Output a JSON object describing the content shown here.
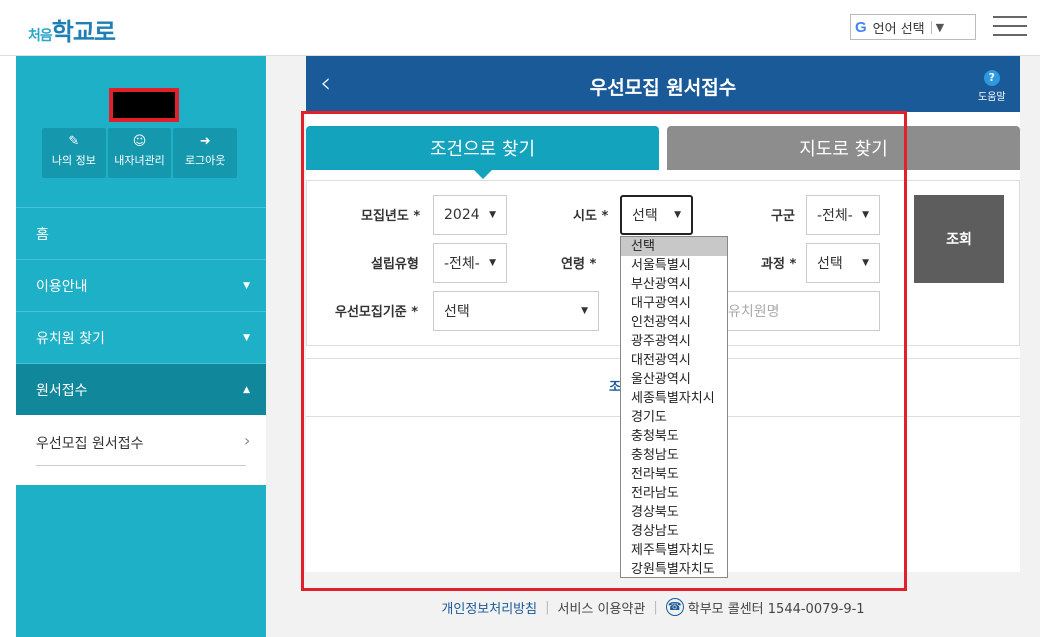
{
  "header": {
    "logo_small": "처음",
    "logo_main": "학교로",
    "lang_g": "G",
    "lang_label": "언어 선택",
    "lang_arrow": "▼"
  },
  "sidebar": {
    "quick": [
      {
        "icon": "✎",
        "label": "나의 정보"
      },
      {
        "icon": "☺",
        "label": "내자녀관리"
      },
      {
        "icon": "➜",
        "label": "로그아웃"
      }
    ],
    "menu": [
      {
        "label": "홈"
      },
      {
        "label": "이용안내"
      },
      {
        "label": "유치원 찾기"
      },
      {
        "label": "원서접수"
      }
    ],
    "submenu": {
      "label": "우선모집 원서접수",
      "chev": "›"
    }
  },
  "page": {
    "back": "‹",
    "title": "우선모집 원서접수",
    "help_q": "?",
    "help_label": "도움말"
  },
  "tabs": {
    "condition": "조건으로 찾기",
    "map": "지도로 찾기"
  },
  "form": {
    "year_label": "모집년도 *",
    "year_value": "2024",
    "sido_label": "시도 *",
    "sido_value": "선택",
    "gugun_label": "구군",
    "gugun_value": "-전체-",
    "type_label": "설립유형",
    "type_value": "-전체-",
    "age_label": "연령 *",
    "course_label": "과정 *",
    "course_value": "선택",
    "criteria_label": "우선모집기준 *",
    "criteria_value": "선택",
    "name_placeholder": "유치원명",
    "search_button": "조회",
    "dd_arrow": "▼",
    "partial_text": "조"
  },
  "dropdown": {
    "options": [
      "선택",
      "서울특별시",
      "부산광역시",
      "대구광역시",
      "인천광역시",
      "광주광역시",
      "대전광역시",
      "울산광역시",
      "세종특별자치시",
      "경기도",
      "충청북도",
      "충청남도",
      "전라북도",
      "전라남도",
      "경상북도",
      "경상남도",
      "제주특별자치도",
      "강원특별자치도"
    ]
  },
  "footer": {
    "privacy": "개인정보처리방침",
    "terms": "서비스 이용약관",
    "phone_icon": "☎",
    "call_center": "학부모 콜센터 1544-0079-9-1",
    "sep": "|"
  }
}
